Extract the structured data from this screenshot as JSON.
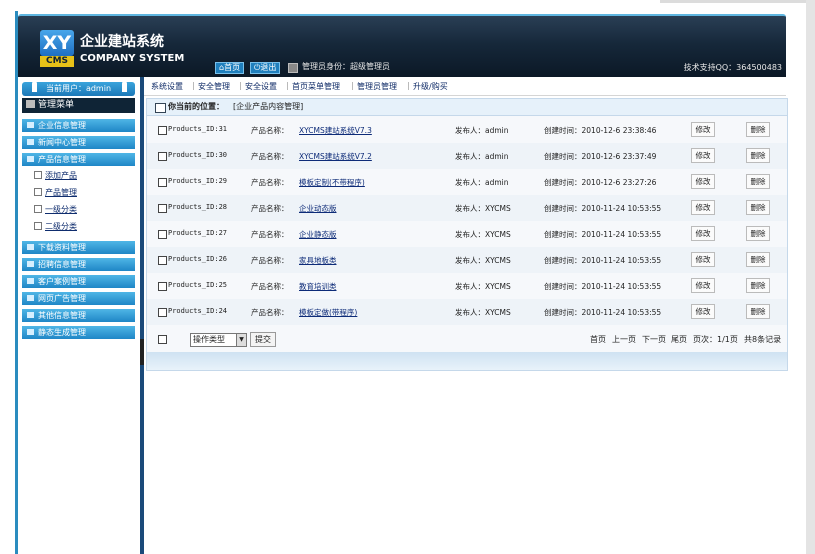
{
  "header": {
    "logo_xy": "XY",
    "logo_cms": "CMS",
    "title_cn": "企业建站系统",
    "title_en": "COMPANY SYSTEM",
    "home_label": "首页",
    "logout_label": "退出",
    "role_text": "管理员身份：超级管理员",
    "support_text": "技术支持QQ：364500483"
  },
  "sidebar": {
    "user_label": "当前用户：admin",
    "menu_title": "管理菜单",
    "groups_top": [
      {
        "label": "企业信息管理"
      },
      {
        "label": "新闻中心管理"
      },
      {
        "label": "产品信息管理"
      }
    ],
    "sub_items": [
      {
        "label": "添加产品"
      },
      {
        "label": "产品管理"
      },
      {
        "label": "一级分类"
      },
      {
        "label": "二级分类"
      }
    ],
    "groups_bottom": [
      {
        "label": "下载资料管理"
      },
      {
        "label": "招聘信息管理"
      },
      {
        "label": "客户案例管理"
      },
      {
        "label": "网页广告管理"
      },
      {
        "label": "其他信息管理"
      },
      {
        "label": "静态生成管理"
      }
    ]
  },
  "toolbar": {
    "items": [
      "系统设置",
      "安全管理",
      "安全设置",
      "首页菜单管理",
      "管理员管理",
      "升级/购买"
    ]
  },
  "content": {
    "position_label": "你当前的位置：",
    "position_value": "[企业产品内容管理]",
    "name_label": "产品名称：",
    "publisher_label": "发布人：",
    "time_label": "创建时间：",
    "edit_label": "修改",
    "delete_label": "删除",
    "rows": [
      {
        "id": "Products_ID:31",
        "name": "XYCMS建站系统V7.3",
        "publisher": "admin",
        "time": "2010-12-6 23:38:46"
      },
      {
        "id": "Products_ID:30",
        "name": "XYCMS建站系统V7.2",
        "publisher": "admin",
        "time": "2010-12-6 23:37:49"
      },
      {
        "id": "Products_ID:29",
        "name": "模板定制(不带程序)",
        "publisher": "admin",
        "time": "2010-12-6 23:27:26"
      },
      {
        "id": "Products_ID:28",
        "name": "企业动态版",
        "publisher": "XYCMS",
        "time": "2010-11-24 10:53:55"
      },
      {
        "id": "Products_ID:27",
        "name": "企业静态版",
        "publisher": "XYCMS",
        "time": "2010-11-24 10:53:55"
      },
      {
        "id": "Products_ID:26",
        "name": "家具地板类",
        "publisher": "XYCMS",
        "time": "2010-11-24 10:53:55"
      },
      {
        "id": "Products_ID:25",
        "name": "教育培训类",
        "publisher": "XYCMS",
        "time": "2010-11-24 10:53:55"
      },
      {
        "id": "Products_ID:24",
        "name": "模板定做(带程序)",
        "publisher": "XYCMS",
        "time": "2010-11-24 10:53:55"
      }
    ],
    "action_select": "操作类型",
    "submit_label": "提交",
    "pager": {
      "first": "首页",
      "prev": "上一页",
      "next": "下一页",
      "last": "尾页",
      "page_info": "页次：1/1页",
      "total": "共8条记录"
    }
  }
}
